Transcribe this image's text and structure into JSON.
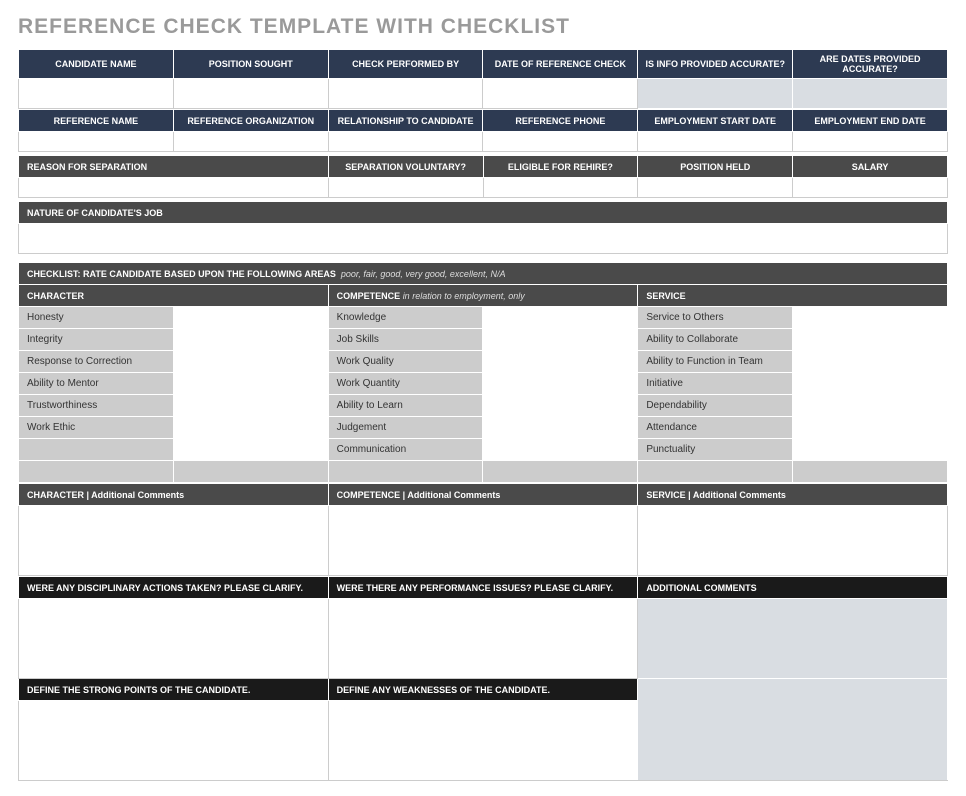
{
  "title": "REFERENCE CHECK TEMPLATE WITH CHECKLIST",
  "row1": {
    "h1": "CANDIDATE NAME",
    "h2": "POSITION SOUGHT",
    "h3": "CHECK PERFORMED BY",
    "h4": "DATE OF REFERENCE CHECK",
    "h5": "IS INFO PROVIDED ACCURATE?",
    "h6": "ARE DATES PROVIDED ACCURATE?"
  },
  "row2": {
    "h1": "REFERENCE NAME",
    "h2": "REFERENCE ORGANIZATION",
    "h3": "RELATIONSHIP TO CANDIDATE",
    "h4": "REFERENCE PHONE",
    "h5": "EMPLOYMENT START DATE",
    "h6": "EMPLOYMENT END DATE"
  },
  "row3": {
    "h1": "REASON FOR SEPARATION",
    "h2": "SEPARATION VOLUNTARY?",
    "h3": "ELIGIBLE FOR REHIRE?",
    "h4": "POSITION HELD",
    "h5": "SALARY"
  },
  "row4": {
    "h1": "NATURE OF CANDIDATE'S JOB"
  },
  "checklist": {
    "title": "CHECKLIST:  RATE CANDIDATE BASED UPON THE FOLLOWING AREAS",
    "hint": "poor, fair, good, very good, excellent, N/A",
    "colA": "CHARACTER",
    "colB": "COMPETENCE",
    "colBhint": "in relation to employment, only",
    "colC": "SERVICE",
    "a1": "Honesty",
    "a2": "Integrity",
    "a3": "Response to Correction",
    "a4": "Ability to Mentor",
    "a5": "Trustworthiness",
    "a6": "Work Ethic",
    "b1": "Knowledge",
    "b2": "Job Skills",
    "b3": "Work Quality",
    "b4": "Work Quantity",
    "b5": "Ability to Learn",
    "b6": "Judgement",
    "b7": "Communication",
    "c1": "Service to Others",
    "c2": "Ability to Collaborate",
    "c3": "Ability to Function in Team",
    "c4": "Initiative",
    "c5": "Dependability",
    "c6": "Attendance",
    "c7": "Punctuality"
  },
  "comments": {
    "charA": "CHARACTER  |  Additional Comments",
    "compA": "COMPETENCE  |  Additional Comments",
    "servA": "SERVICE  |  Additional Comments",
    "q1": "WERE ANY DISCIPLINARY ACTIONS TAKEN? PLEASE CLARIFY.",
    "q2": "WERE THERE ANY PERFORMANCE ISSUES? PLEASE CLARIFY.",
    "q3": "ADDITIONAL COMMENTS",
    "q4": "DEFINE THE STRONG POINTS OF THE CANDIDATE.",
    "q5": "DEFINE ANY WEAKNESSES OF THE CANDIDATE."
  }
}
